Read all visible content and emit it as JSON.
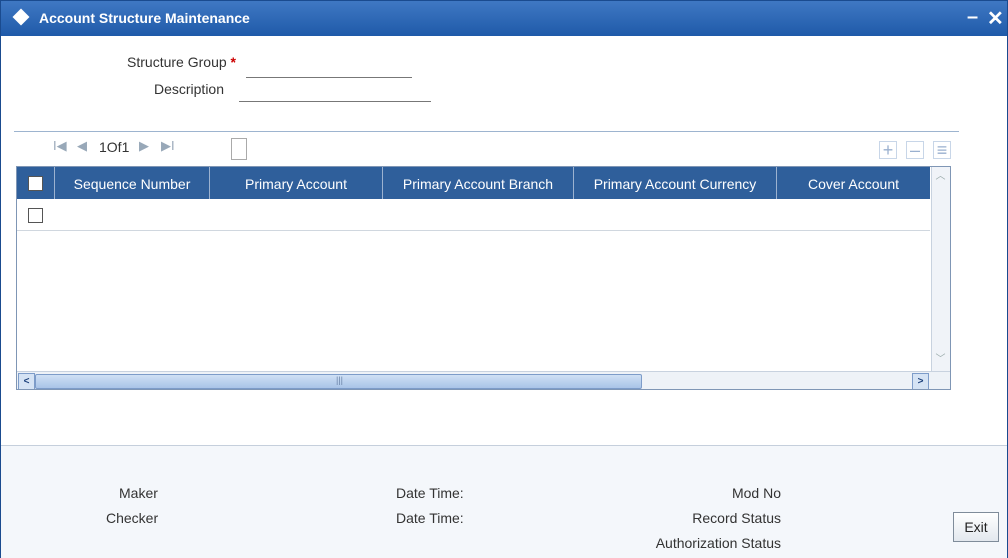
{
  "window": {
    "title": "Account Structure Maintenance",
    "minimize": "–",
    "close": "✕"
  },
  "form": {
    "structure_group_label": "Structure Group",
    "required_mark": "*",
    "structure_group_value": "",
    "description_label": "Description",
    "description_value": ""
  },
  "pager": {
    "first": "I◀",
    "prev": "◀",
    "page_text": "1Of1",
    "next": "▶",
    "last": "▶I"
  },
  "toolbar": {
    "add": "+",
    "remove": "–",
    "view": "≡"
  },
  "grid": {
    "columns": [
      "Sequence Number",
      "Primary Account",
      "Primary Account Branch",
      "Primary Account Currency",
      "Cover Account"
    ],
    "rows": [
      {
        "sequence_number": "",
        "primary_account": "",
        "primary_account_branch": "",
        "primary_account_currency": "",
        "cover_account": ""
      }
    ],
    "hscroll_grip": "|||"
  },
  "footer": {
    "maker": "Maker",
    "checker": "Checker",
    "date_time_1": "Date Time:",
    "date_time_2": "Date Time:",
    "mod_no": "Mod No",
    "record_status": "Record Status",
    "authorization_status": "Authorization Status",
    "exit": "Exit"
  },
  "colors": {
    "titlebar": "#2a65b3",
    "grid_header": "#2f5f9b",
    "required": "#cc0000"
  }
}
